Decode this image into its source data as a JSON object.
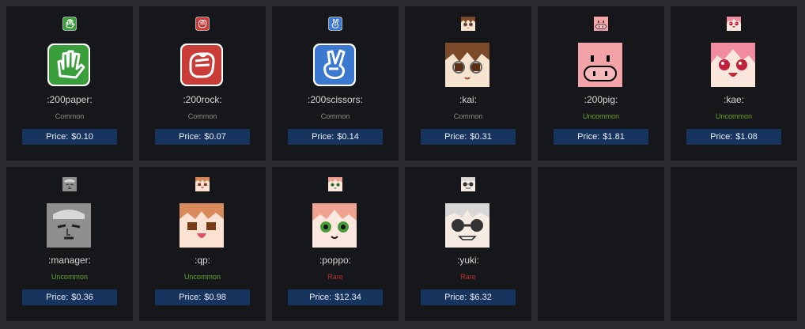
{
  "items": [
    {
      "name": ":200paper:",
      "rarity": "Common",
      "price_label": "Price:",
      "price": "$0.10",
      "icon": "paper-hand-icon",
      "rarity_color": "#8c8c8c"
    },
    {
      "name": ":200rock:",
      "rarity": "Common",
      "price_label": "Price:",
      "price": "$0.07",
      "icon": "rock-fist-icon",
      "rarity_color": "#8c8c8c"
    },
    {
      "name": ":200scissors:",
      "rarity": "Common",
      "price_label": "Price:",
      "price": "$0.14",
      "icon": "scissors-hand-icon",
      "rarity_color": "#8c8c8c"
    },
    {
      "name": ":kai:",
      "rarity": "Common",
      "price_label": "Price:",
      "price": "$0.31",
      "icon": "kai-face-icon",
      "rarity_color": "#8c8c8c"
    },
    {
      "name": ":200pig:",
      "rarity": "Uncommon",
      "price_label": "Price:",
      "price": "$1.81",
      "icon": "pig-face-icon",
      "rarity_color": "#6aa32a"
    },
    {
      "name": ":kae:",
      "rarity": "Uncommon",
      "price_label": "Price:",
      "price": "$1.08",
      "icon": "kae-face-icon",
      "rarity_color": "#6aa32a"
    },
    {
      "name": ":manager:",
      "rarity": "Uncommon",
      "price_label": "Price:",
      "price": "$0.36",
      "icon": "manager-face-icon",
      "rarity_color": "#6aa32a"
    },
    {
      "name": ":qp:",
      "rarity": "Uncommon",
      "price_label": "Price:",
      "price": "$0.98",
      "icon": "qp-face-icon",
      "rarity_color": "#6aa32a"
    },
    {
      "name": ":poppo:",
      "rarity": "Rare",
      "price_label": "Price:",
      "price": "$12.34",
      "icon": "poppo-face-icon",
      "rarity_color": "#b8312f"
    },
    {
      "name": ":yuki:",
      "rarity": "Rare",
      "price_label": "Price:",
      "price": "$6.32",
      "icon": "yuki-face-icon",
      "rarity_color": "#b8312f"
    }
  ],
  "colors": {
    "background": "#2a2b2e",
    "card": "#16171a",
    "price_button": "#17345f",
    "common": "#8c8c8c",
    "uncommon": "#6aa32a",
    "rare": "#b8312f"
  }
}
